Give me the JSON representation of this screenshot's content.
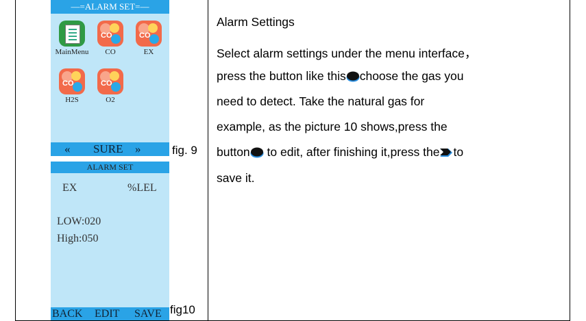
{
  "fig9": {
    "title": "—=ALARM SET=—",
    "apps": [
      {
        "label": "MainMenu"
      },
      {
        "label": "CO"
      },
      {
        "label": "EX"
      },
      {
        "label": "H2S"
      },
      {
        "label": "O2"
      }
    ],
    "gas_icon_text": "CO",
    "nav_left": "«",
    "sure": "SURE",
    "nav_right": "»",
    "caption": "fig. 9"
  },
  "fig10": {
    "title": "ALARM SET",
    "gas": "EX",
    "unit": "%LEL",
    "low": "LOW:020",
    "high": "High:050",
    "back": "BACK",
    "edit": "EDIT",
    "save": "SAVE",
    "caption": "fig10"
  },
  "text": {
    "heading": "Alarm Settings",
    "line1": "Select alarm settings under the menu interface，",
    "line2a": "press the button like this",
    "line2b": "choose the gas you",
    "line3": "need to detect. Take the natural gas for",
    "line4": "example, as the picture 10 shows,press the",
    "line5a": "button",
    "line5b": " to edit, after finishing it,press the",
    "line5c": "to",
    "line6": "save it."
  },
  "colors": {
    "screen_bg": "#bfe6f8",
    "bar_blue": "#2aa3e6",
    "icon_green": "#2f9a44",
    "icon_orange": "#f26a4a",
    "button_dark": "#111111",
    "button_blue": "#2b8fe0"
  },
  "icons": {
    "down_button": "oval-button-icon",
    "save_button": "chevron-right-button-icon"
  }
}
